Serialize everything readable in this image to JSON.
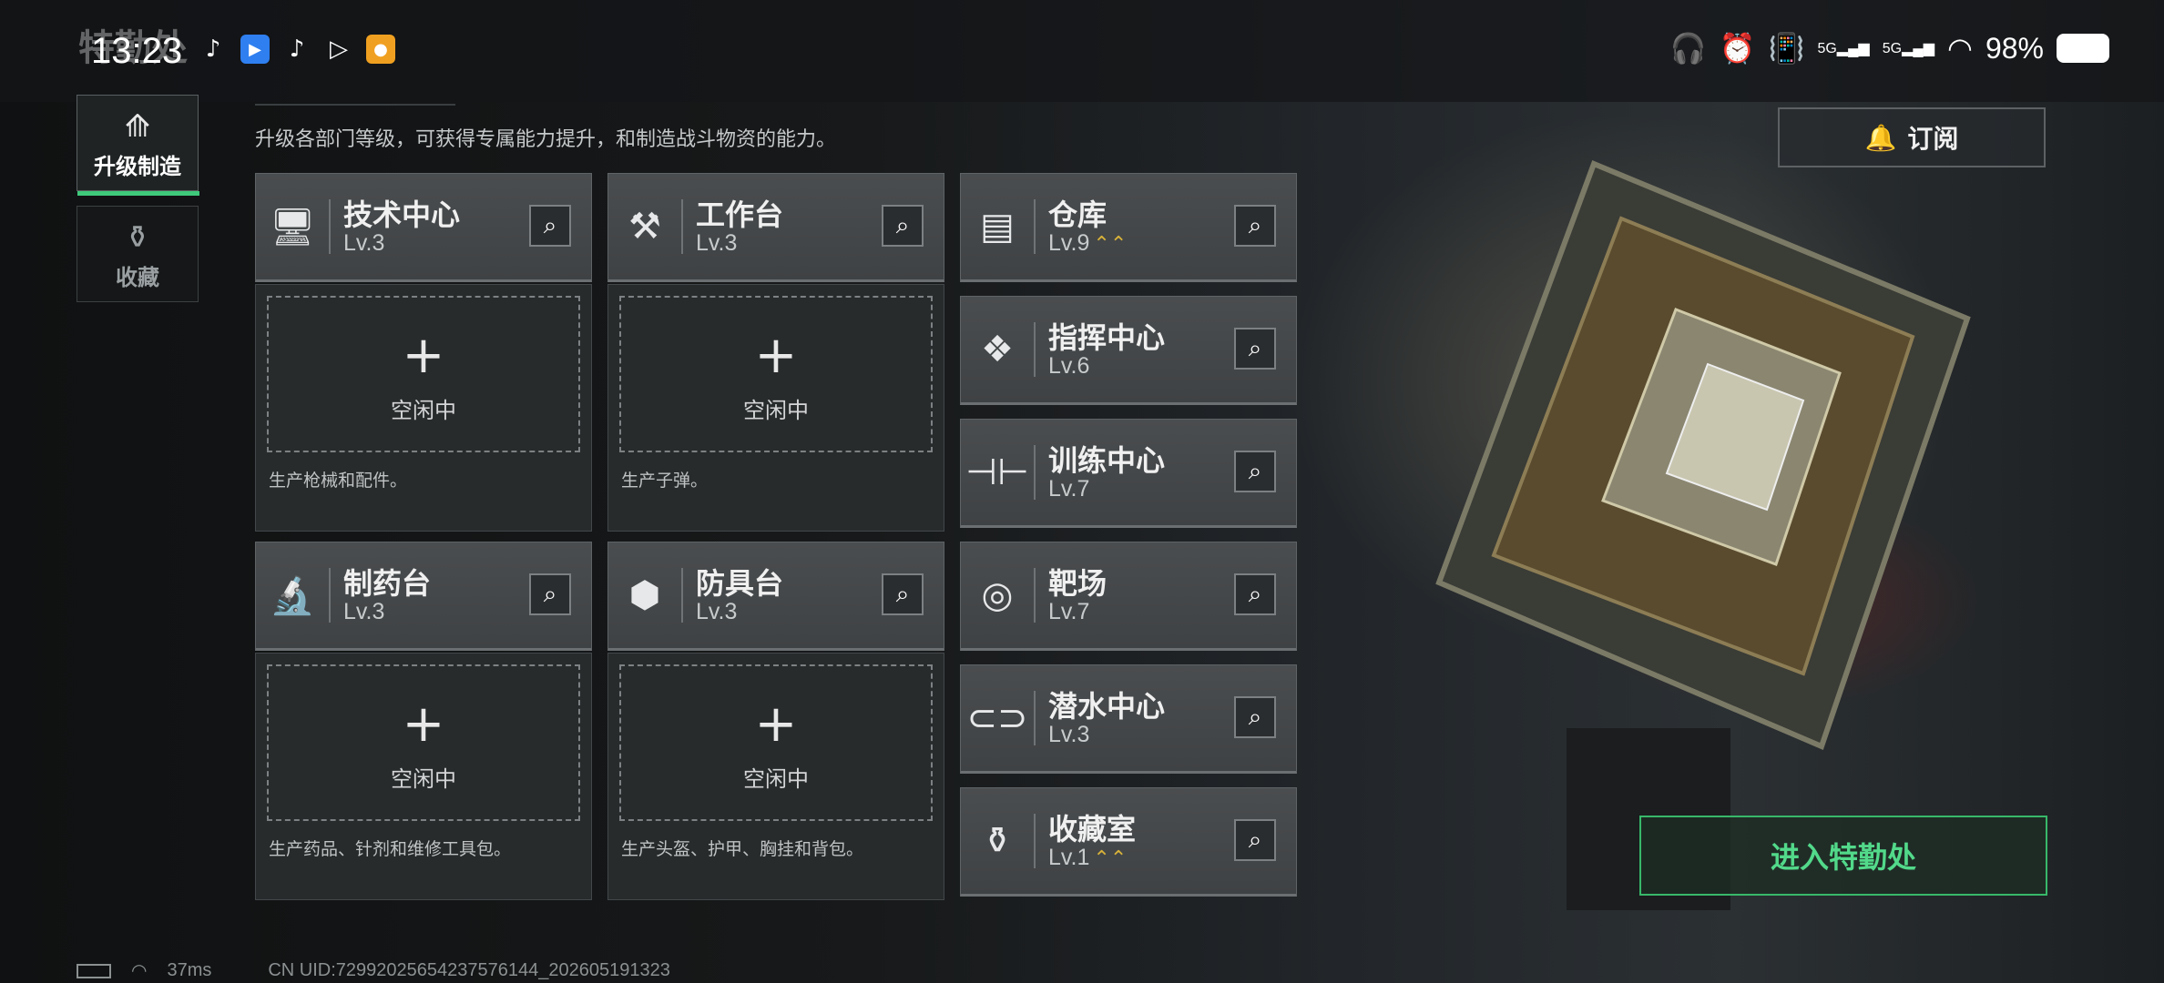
{
  "status_bar": {
    "time": "13:23",
    "battery": "98%",
    "network_labels": [
      "5G",
      "5G"
    ]
  },
  "header": {
    "title": "特勤处"
  },
  "sidebar": {
    "tabs": [
      {
        "label": "升级制造",
        "active": true
      },
      {
        "label": "收藏",
        "active": false
      }
    ]
  },
  "description": "升级各部门等级，可获得专属能力提升，和制造战斗物资的能力。",
  "subscribe_label": "订阅",
  "enter_label": "进入特勤处",
  "workshops": [
    {
      "name": "技术中心",
      "level": "Lv.3",
      "status": "空闲中",
      "desc": "生产枪械和配件。"
    },
    {
      "name": "工作台",
      "level": "Lv.3",
      "status": "空闲中",
      "desc": "生产子弹。"
    },
    {
      "name": "制药台",
      "level": "Lv.3",
      "status": "空闲中",
      "desc": "生产药品、针剂和维修工具包。"
    },
    {
      "name": "防具台",
      "level": "Lv.3",
      "status": "空闲中",
      "desc": "生产头盔、护甲、胸挂和背包。"
    }
  ],
  "facilities": [
    {
      "name": "仓库",
      "level": "Lv.9",
      "upgradable": true
    },
    {
      "name": "指挥中心",
      "level": "Lv.6",
      "upgradable": false
    },
    {
      "name": "训练中心",
      "level": "Lv.7",
      "upgradable": false
    },
    {
      "name": "靶场",
      "level": "Lv.7",
      "upgradable": false
    },
    {
      "name": "潜水中心",
      "level": "Lv.3",
      "upgradable": false
    },
    {
      "name": "收藏室",
      "level": "Lv.1",
      "upgradable": true
    }
  ],
  "footer": {
    "ping": "37ms",
    "uid": "CN UID:72992025654237576144_202605191323"
  },
  "colors": {
    "accent_green": "#3ec97b",
    "upgrade_gold": "#d8b23a"
  }
}
